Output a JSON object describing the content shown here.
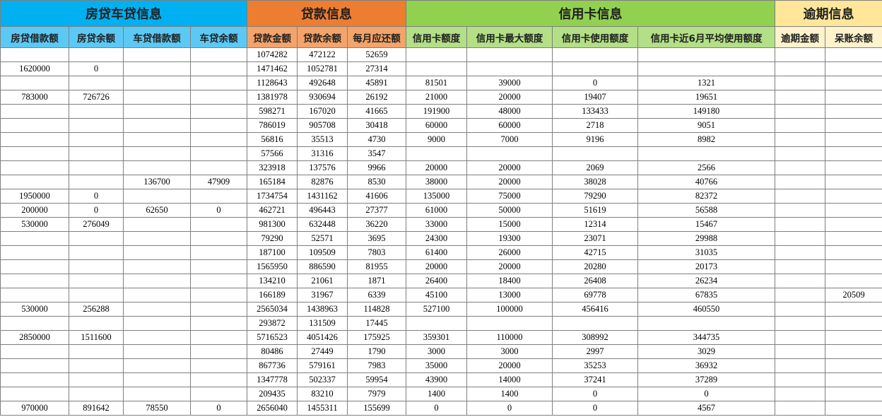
{
  "groups": {
    "house_car": "房贷车贷信息",
    "loan": "贷款信息",
    "credit_card": "信用卡信息",
    "overdue": "逾期信息"
  },
  "columns": [
    "房贷借款额",
    "房贷余额",
    "车贷借款额",
    "车贷余额",
    "贷款金额",
    "贷款余额",
    "每月应还额",
    "信用卡额度",
    "信用卡最大额度",
    "信用卡使用额度",
    "信用卡近6月平均使用额度",
    "逾期金额",
    "呆账余额"
  ],
  "rows": [
    [
      "",
      "",
      "",
      "",
      "1074282",
      "472122",
      "52659",
      "",
      "",
      "",
      "",
      "",
      ""
    ],
    [
      "1620000",
      "0",
      "",
      "",
      "1471462",
      "1052781",
      "27314",
      "",
      "",
      "",
      "",
      "",
      ""
    ],
    [
      "",
      "",
      "",
      "",
      "1128643",
      "492648",
      "45891",
      "81501",
      "39000",
      "0",
      "1321",
      "",
      ""
    ],
    [
      "783000",
      "726726",
      "",
      "",
      "1381978",
      "930694",
      "26192",
      "21000",
      "20000",
      "19407",
      "19651",
      "",
      ""
    ],
    [
      "",
      "",
      "",
      "",
      "598271",
      "167020",
      "41665",
      "191900",
      "48000",
      "133433",
      "149180",
      "",
      ""
    ],
    [
      "",
      "",
      "",
      "",
      "786019",
      "905708",
      "30418",
      "60000",
      "60000",
      "2718",
      "9051",
      "",
      ""
    ],
    [
      "",
      "",
      "",
      "",
      "56816",
      "35513",
      "4730",
      "9000",
      "7000",
      "9196",
      "8982",
      "",
      ""
    ],
    [
      "",
      "",
      "",
      "",
      "57566",
      "31316",
      "3547",
      "",
      "",
      "",
      "",
      "",
      ""
    ],
    [
      "",
      "",
      "",
      "",
      "323918",
      "137576",
      "9966",
      "20000",
      "20000",
      "2069",
      "2566",
      "",
      ""
    ],
    [
      "",
      "",
      "136700",
      "47909",
      "165184",
      "82876",
      "8530",
      "38000",
      "20000",
      "38028",
      "40766",
      "",
      ""
    ],
    [
      "1950000",
      "0",
      "",
      "",
      "1734754",
      "1431162",
      "41606",
      "135000",
      "75000",
      "79290",
      "82372",
      "",
      ""
    ],
    [
      "200000",
      "0",
      "62650",
      "0",
      "462721",
      "496443",
      "27377",
      "61000",
      "50000",
      "51619",
      "56588",
      "",
      ""
    ],
    [
      "530000",
      "276049",
      "",
      "",
      "981300",
      "632448",
      "36220",
      "33000",
      "15000",
      "12314",
      "15467",
      "",
      ""
    ],
    [
      "",
      "",
      "",
      "",
      "79290",
      "52571",
      "3695",
      "24300",
      "19300",
      "23071",
      "29988",
      "",
      ""
    ],
    [
      "",
      "",
      "",
      "",
      "187100",
      "109509",
      "7803",
      "61400",
      "26000",
      "42715",
      "31035",
      "",
      ""
    ],
    [
      "",
      "",
      "",
      "",
      "1565950",
      "886590",
      "81955",
      "20000",
      "20000",
      "20280",
      "20173",
      "",
      ""
    ],
    [
      "",
      "",
      "",
      "",
      "134210",
      "21061",
      "1871",
      "26400",
      "18400",
      "26408",
      "26234",
      "",
      ""
    ],
    [
      "",
      "",
      "",
      "",
      "166189",
      "31967",
      "6339",
      "45100",
      "13000",
      "69778",
      "67835",
      "",
      "20509"
    ],
    [
      "530000",
      "256288",
      "",
      "",
      "2565034",
      "1438963",
      "114828",
      "527100",
      "100000",
      "456416",
      "460550",
      "",
      ""
    ],
    [
      "",
      "",
      "",
      "",
      "293872",
      "131509",
      "17445",
      "",
      "",
      "",
      "",
      "",
      ""
    ],
    [
      "2850000",
      "1511600",
      "",
      "",
      "5716523",
      "4051426",
      "175925",
      "359301",
      "110000",
      "308992",
      "344735",
      "",
      ""
    ],
    [
      "",
      "",
      "",
      "",
      "80486",
      "27449",
      "1790",
      "3000",
      "3000",
      "2997",
      "3029",
      "",
      ""
    ],
    [
      "",
      "",
      "",
      "",
      "867736",
      "579161",
      "7983",
      "35000",
      "20000",
      "35253",
      "36932",
      "",
      ""
    ],
    [
      "",
      "",
      "",
      "",
      "1347778",
      "502337",
      "59954",
      "43900",
      "14000",
      "37241",
      "37289",
      "",
      ""
    ],
    [
      "",
      "",
      "",
      "",
      "209435",
      "83210",
      "7979",
      "1400",
      "1400",
      "0",
      "0",
      "",
      ""
    ],
    [
      "970000",
      "891642",
      "78550",
      "0",
      "2656040",
      "1455311",
      "155699",
      "0",
      "0",
      "0",
      "4567",
      "",
      ""
    ]
  ],
  "colors": {
    "house_car_header": "#00b0f0",
    "loan_header": "#ed7d31",
    "credit_card_header": "#92d050",
    "overdue_header": "#ffe699"
  }
}
